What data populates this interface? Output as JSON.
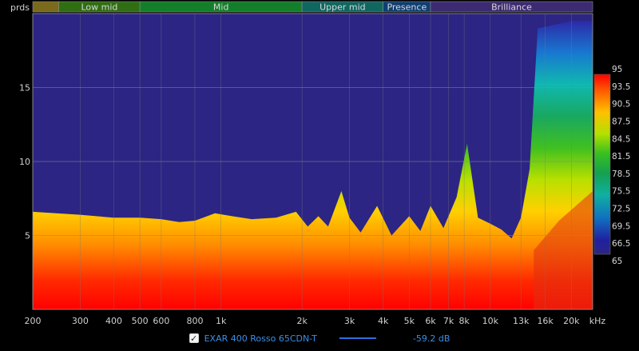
{
  "chart_data": {
    "type": "heatmap",
    "y_unit": "prds",
    "x_unit": "kHz",
    "x_ticks": [
      {
        "value": 200,
        "label": "200"
      },
      {
        "value": 300,
        "label": "300"
      },
      {
        "value": 400,
        "label": "400"
      },
      {
        "value": 500,
        "label": "500"
      },
      {
        "value": 600,
        "label": "600"
      },
      {
        "value": 800,
        "label": "800"
      },
      {
        "value": 1000,
        "label": "1k"
      },
      {
        "value": 2000,
        "label": "2k"
      },
      {
        "value": 3000,
        "label": "3k"
      },
      {
        "value": 4000,
        "label": "4k"
      },
      {
        "value": 5000,
        "label": "5k"
      },
      {
        "value": 6000,
        "label": "6k"
      },
      {
        "value": 7000,
        "label": "7k"
      },
      {
        "value": 8000,
        "label": "8k"
      },
      {
        "value": 10000,
        "label": "10k"
      },
      {
        "value": 13000,
        "label": "13k"
      },
      {
        "value": 16000,
        "label": "16k"
      },
      {
        "value": 20000,
        "label": "20k"
      }
    ],
    "x_range": [
      200,
      24000
    ],
    "x_scale": "log",
    "y_ticks": [
      {
        "value": 5,
        "label": "5"
      },
      {
        "value": 10,
        "label": "10"
      },
      {
        "value": 15,
        "label": "15"
      }
    ],
    "y_range": [
      0,
      20
    ],
    "bands": [
      {
        "label": "",
        "from": 200,
        "to": 250,
        "color": "#7a6a1c"
      },
      {
        "label": "Low mid",
        "from": 250,
        "to": 500,
        "color": "#2f6e12"
      },
      {
        "label": "Mid",
        "from": 500,
        "to": 2000,
        "color": "#137f2a"
      },
      {
        "label": "Upper mid",
        "from": 2000,
        "to": 4000,
        "color": "#0f6760"
      },
      {
        "label": "Presence",
        "from": 4000,
        "to": 6000,
        "color": "#0f3f72"
      },
      {
        "label": "Brilliance",
        "from": 6000,
        "to": 24000,
        "color": "#3c2a72"
      }
    ],
    "color_scale": {
      "min": 65,
      "max": 95,
      "labels": [
        "95",
        "93.5",
        "90.5",
        "87.5",
        "84.5",
        "81.5",
        "78.5",
        "75.5",
        "72.5",
        "69.5",
        "66.5",
        "65"
      ],
      "stops": [
        "#ff0000",
        "#ff5a00",
        "#ffc000",
        "#b4e000",
        "#38c020",
        "#14a050",
        "#10b0a0",
        "#1070c0",
        "#2020a0",
        "#2c2584"
      ]
    },
    "decay_profile": [
      {
        "f": 200,
        "t": 6.6
      },
      {
        "f": 300,
        "t": 6.4
      },
      {
        "f": 400,
        "t": 6.2
      },
      {
        "f": 500,
        "t": 6.2
      },
      {
        "f": 600,
        "t": 6.1
      },
      {
        "f": 700,
        "t": 5.9
      },
      {
        "f": 800,
        "t": 6.0
      },
      {
        "f": 950,
        "t": 6.5
      },
      {
        "f": 1100,
        "t": 6.3
      },
      {
        "f": 1300,
        "t": 6.1
      },
      {
        "f": 1600,
        "t": 6.2
      },
      {
        "f": 1900,
        "t": 6.6
      },
      {
        "f": 2100,
        "t": 5.6
      },
      {
        "f": 2300,
        "t": 6.3
      },
      {
        "f": 2500,
        "t": 5.6
      },
      {
        "f": 2800,
        "t": 8.0
      },
      {
        "f": 3000,
        "t": 6.2
      },
      {
        "f": 3300,
        "t": 5.2
      },
      {
        "f": 3800,
        "t": 7.0
      },
      {
        "f": 4300,
        "t": 5.0
      },
      {
        "f": 5000,
        "t": 6.3
      },
      {
        "f": 5500,
        "t": 5.3
      },
      {
        "f": 6000,
        "t": 7.0
      },
      {
        "f": 6700,
        "t": 5.5
      },
      {
        "f": 7500,
        "t": 7.6
      },
      {
        "f": 8200,
        "t": 11.2
      },
      {
        "f": 9000,
        "t": 6.2
      },
      {
        "f": 10000,
        "t": 5.8
      },
      {
        "f": 11000,
        "t": 5.4
      },
      {
        "f": 12000,
        "t": 4.8
      },
      {
        "f": 13000,
        "t": 6.2
      },
      {
        "f": 14000,
        "t": 9.5
      },
      {
        "f": 15000,
        "t": 19.0
      },
      {
        "f": 20000,
        "t": 19.5
      },
      {
        "f": 24000,
        "t": 19.5
      }
    ],
    "series": [
      {
        "name": "EXAR 400 Rosso 65CDN-T",
        "value_label": "-59.2 dB",
        "color": "#2f6fe0"
      }
    ]
  },
  "legend": {
    "checkbox_glyph": "✓",
    "checked": true
  }
}
